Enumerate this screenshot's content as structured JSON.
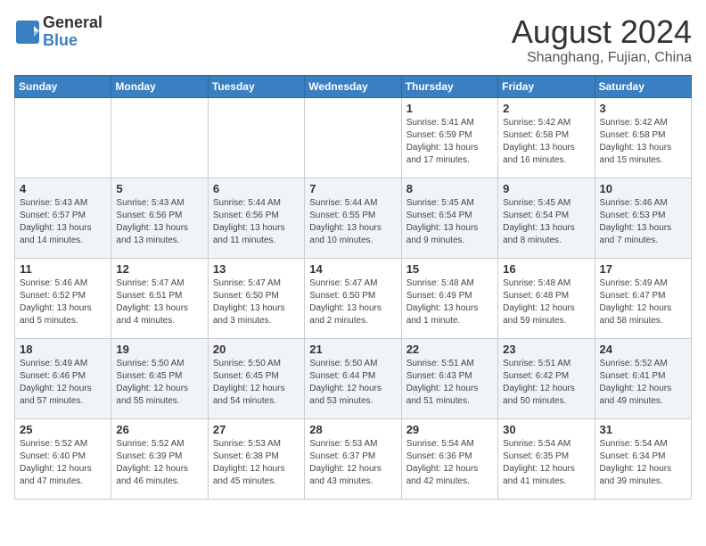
{
  "logo": {
    "general": "General",
    "blue": "Blue"
  },
  "title": {
    "month_year": "August 2024",
    "location": "Shanghang, Fujian, China"
  },
  "weekdays": [
    "Sunday",
    "Monday",
    "Tuesday",
    "Wednesday",
    "Thursday",
    "Friday",
    "Saturday"
  ],
  "weeks": [
    [
      {
        "day": "",
        "info": ""
      },
      {
        "day": "",
        "info": ""
      },
      {
        "day": "",
        "info": ""
      },
      {
        "day": "",
        "info": ""
      },
      {
        "day": "1",
        "info": "Sunrise: 5:41 AM\nSunset: 6:59 PM\nDaylight: 13 hours\nand 17 minutes."
      },
      {
        "day": "2",
        "info": "Sunrise: 5:42 AM\nSunset: 6:58 PM\nDaylight: 13 hours\nand 16 minutes."
      },
      {
        "day": "3",
        "info": "Sunrise: 5:42 AM\nSunset: 6:58 PM\nDaylight: 13 hours\nand 15 minutes."
      }
    ],
    [
      {
        "day": "4",
        "info": "Sunrise: 5:43 AM\nSunset: 6:57 PM\nDaylight: 13 hours\nand 14 minutes."
      },
      {
        "day": "5",
        "info": "Sunrise: 5:43 AM\nSunset: 6:56 PM\nDaylight: 13 hours\nand 13 minutes."
      },
      {
        "day": "6",
        "info": "Sunrise: 5:44 AM\nSunset: 6:56 PM\nDaylight: 13 hours\nand 11 minutes."
      },
      {
        "day": "7",
        "info": "Sunrise: 5:44 AM\nSunset: 6:55 PM\nDaylight: 13 hours\nand 10 minutes."
      },
      {
        "day": "8",
        "info": "Sunrise: 5:45 AM\nSunset: 6:54 PM\nDaylight: 13 hours\nand 9 minutes."
      },
      {
        "day": "9",
        "info": "Sunrise: 5:45 AM\nSunset: 6:54 PM\nDaylight: 13 hours\nand 8 minutes."
      },
      {
        "day": "10",
        "info": "Sunrise: 5:46 AM\nSunset: 6:53 PM\nDaylight: 13 hours\nand 7 minutes."
      }
    ],
    [
      {
        "day": "11",
        "info": "Sunrise: 5:46 AM\nSunset: 6:52 PM\nDaylight: 13 hours\nand 5 minutes."
      },
      {
        "day": "12",
        "info": "Sunrise: 5:47 AM\nSunset: 6:51 PM\nDaylight: 13 hours\nand 4 minutes."
      },
      {
        "day": "13",
        "info": "Sunrise: 5:47 AM\nSunset: 6:50 PM\nDaylight: 13 hours\nand 3 minutes."
      },
      {
        "day": "14",
        "info": "Sunrise: 5:47 AM\nSunset: 6:50 PM\nDaylight: 13 hours\nand 2 minutes."
      },
      {
        "day": "15",
        "info": "Sunrise: 5:48 AM\nSunset: 6:49 PM\nDaylight: 13 hours\nand 1 minute."
      },
      {
        "day": "16",
        "info": "Sunrise: 5:48 AM\nSunset: 6:48 PM\nDaylight: 12 hours\nand 59 minutes."
      },
      {
        "day": "17",
        "info": "Sunrise: 5:49 AM\nSunset: 6:47 PM\nDaylight: 12 hours\nand 58 minutes."
      }
    ],
    [
      {
        "day": "18",
        "info": "Sunrise: 5:49 AM\nSunset: 6:46 PM\nDaylight: 12 hours\nand 57 minutes."
      },
      {
        "day": "19",
        "info": "Sunrise: 5:50 AM\nSunset: 6:45 PM\nDaylight: 12 hours\nand 55 minutes."
      },
      {
        "day": "20",
        "info": "Sunrise: 5:50 AM\nSunset: 6:45 PM\nDaylight: 12 hours\nand 54 minutes."
      },
      {
        "day": "21",
        "info": "Sunrise: 5:50 AM\nSunset: 6:44 PM\nDaylight: 12 hours\nand 53 minutes."
      },
      {
        "day": "22",
        "info": "Sunrise: 5:51 AM\nSunset: 6:43 PM\nDaylight: 12 hours\nand 51 minutes."
      },
      {
        "day": "23",
        "info": "Sunrise: 5:51 AM\nSunset: 6:42 PM\nDaylight: 12 hours\nand 50 minutes."
      },
      {
        "day": "24",
        "info": "Sunrise: 5:52 AM\nSunset: 6:41 PM\nDaylight: 12 hours\nand 49 minutes."
      }
    ],
    [
      {
        "day": "25",
        "info": "Sunrise: 5:52 AM\nSunset: 6:40 PM\nDaylight: 12 hours\nand 47 minutes."
      },
      {
        "day": "26",
        "info": "Sunrise: 5:52 AM\nSunset: 6:39 PM\nDaylight: 12 hours\nand 46 minutes."
      },
      {
        "day": "27",
        "info": "Sunrise: 5:53 AM\nSunset: 6:38 PM\nDaylight: 12 hours\nand 45 minutes."
      },
      {
        "day": "28",
        "info": "Sunrise: 5:53 AM\nSunset: 6:37 PM\nDaylight: 12 hours\nand 43 minutes."
      },
      {
        "day": "29",
        "info": "Sunrise: 5:54 AM\nSunset: 6:36 PM\nDaylight: 12 hours\nand 42 minutes."
      },
      {
        "day": "30",
        "info": "Sunrise: 5:54 AM\nSunset: 6:35 PM\nDaylight: 12 hours\nand 41 minutes."
      },
      {
        "day": "31",
        "info": "Sunrise: 5:54 AM\nSunset: 6:34 PM\nDaylight: 12 hours\nand 39 minutes."
      }
    ]
  ]
}
